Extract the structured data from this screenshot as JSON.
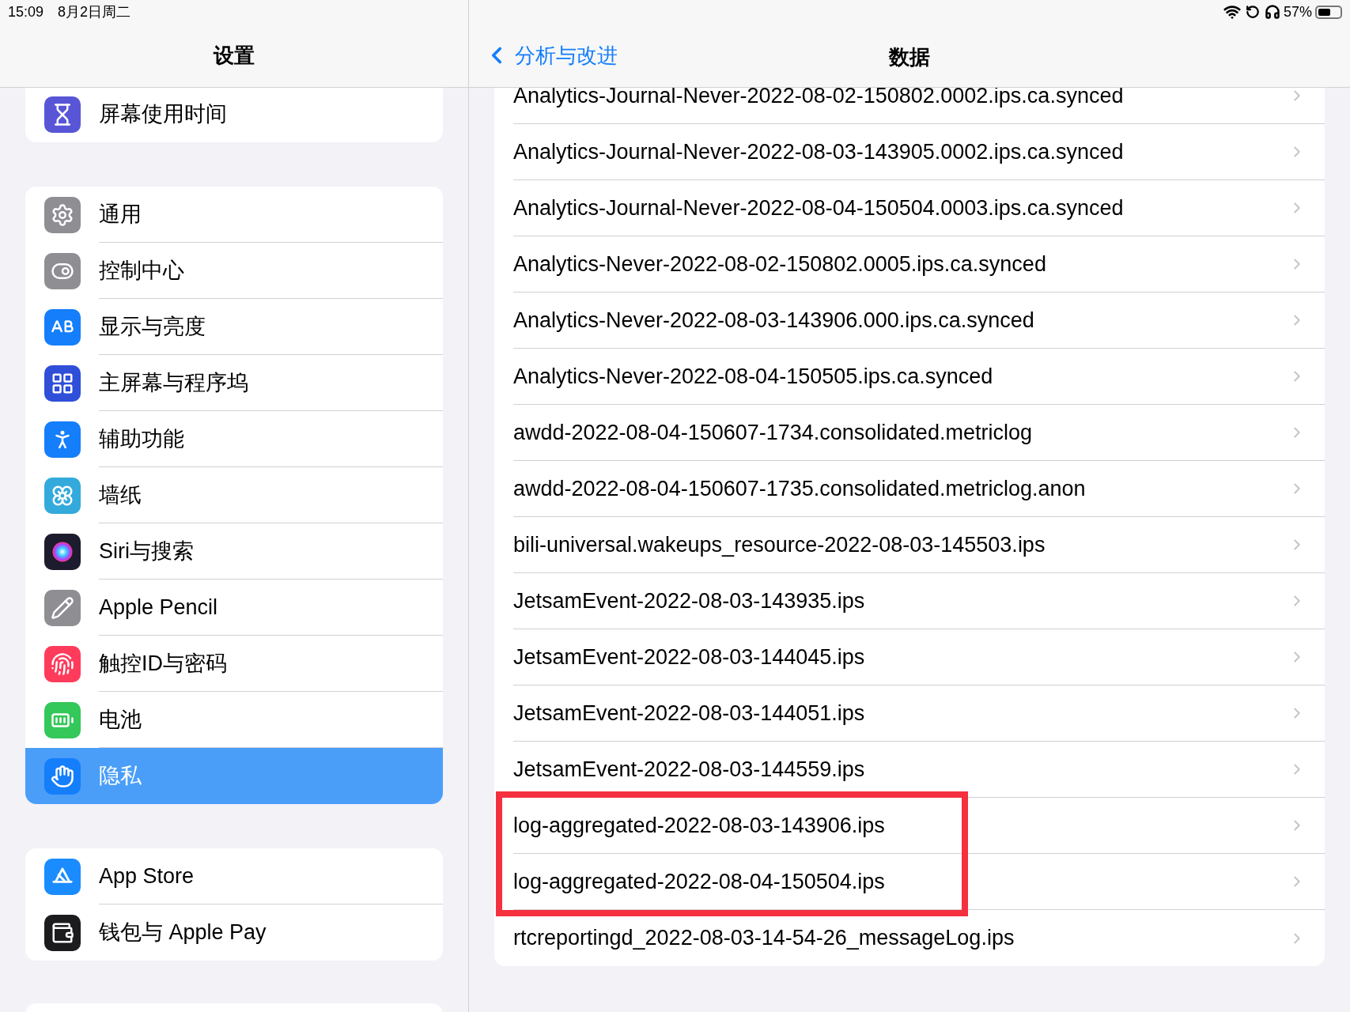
{
  "status_bar": {
    "time": "15:09",
    "date": "8月2日周二",
    "battery": "57%"
  },
  "sidebar": {
    "title": "设置",
    "groups": [
      {
        "items": [
          {
            "label": "屏幕使用时间",
            "kind": "hourglass",
            "color": "#5856d6",
            "selected": false
          }
        ]
      },
      {
        "items": [
          {
            "label": "通用",
            "kind": "gear",
            "color": "#8e8e93",
            "selected": false
          },
          {
            "label": "控制中心",
            "kind": "toggles",
            "color": "#8e8e93",
            "selected": false
          },
          {
            "label": "显示与亮度",
            "kind": "letters",
            "color": "#147efb",
            "selected": false
          },
          {
            "label": "主屏幕与程序坞",
            "kind": "grid",
            "color": "#2f4fd8",
            "selected": false
          },
          {
            "label": "辅助功能",
            "kind": "accessibility",
            "color": "#147efb",
            "selected": false
          },
          {
            "label": "墙纸",
            "kind": "flower",
            "color": "#34aadc",
            "selected": false
          },
          {
            "label": "Siri与搜索",
            "kind": "orb",
            "color": "#1c1c2e",
            "selected": false
          },
          {
            "label": "Apple Pencil",
            "kind": "pencil",
            "color": "#8e8e93",
            "selected": false
          },
          {
            "label": "触控ID与密码",
            "kind": "fingerprint",
            "color": "#ff3b5c",
            "selected": false
          },
          {
            "label": "电池",
            "kind": "battery",
            "color": "#34c759",
            "selected": false
          },
          {
            "label": "隐私",
            "kind": "hand",
            "color": "#147efb",
            "selected": true
          }
        ]
      },
      {
        "items": [
          {
            "label": "App Store",
            "kind": "appstore",
            "color": "#1a8cff",
            "selected": false
          },
          {
            "label": "钱包与 Apple Pay",
            "kind": "wallet",
            "color": "#1c1c1e",
            "selected": false
          }
        ]
      }
    ]
  },
  "detail": {
    "back": "分析与改进",
    "title": "数据",
    "rows": [
      {
        "label": "Analytics-Journal-Never-2022-08-02-150802.0002.ips.ca.synced",
        "boxed": false
      },
      {
        "label": "Analytics-Journal-Never-2022-08-03-143905.0002.ips.ca.synced",
        "boxed": false
      },
      {
        "label": "Analytics-Journal-Never-2022-08-04-150504.0003.ips.ca.synced",
        "boxed": false
      },
      {
        "label": "Analytics-Never-2022-08-02-150802.0005.ips.ca.synced",
        "boxed": false
      },
      {
        "label": "Analytics-Never-2022-08-03-143906.000.ips.ca.synced",
        "boxed": false
      },
      {
        "label": "Analytics-Never-2022-08-04-150505.ips.ca.synced",
        "boxed": false
      },
      {
        "label": "awdd-2022-08-04-150607-1734.consolidated.metriclog",
        "boxed": false
      },
      {
        "label": "awdd-2022-08-04-150607-1735.consolidated.metriclog.anon",
        "boxed": false
      },
      {
        "label": "bili-universal.wakeups_resource-2022-08-03-145503.ips",
        "boxed": false
      },
      {
        "label": "JetsamEvent-2022-08-03-143935.ips",
        "boxed": false
      },
      {
        "label": "JetsamEvent-2022-08-03-144045.ips",
        "boxed": false
      },
      {
        "label": "JetsamEvent-2022-08-03-144051.ips",
        "boxed": false
      },
      {
        "label": "JetsamEvent-2022-08-03-144559.ips",
        "boxed": false
      },
      {
        "label": "log-aggregated-2022-08-03-143906.ips",
        "boxed": true
      },
      {
        "label": "log-aggregated-2022-08-04-150504.ips",
        "boxed": true
      },
      {
        "label": "rtcreportingd_2022-08-03-14-54-26_messageLog.ips",
        "boxed": false
      }
    ]
  }
}
